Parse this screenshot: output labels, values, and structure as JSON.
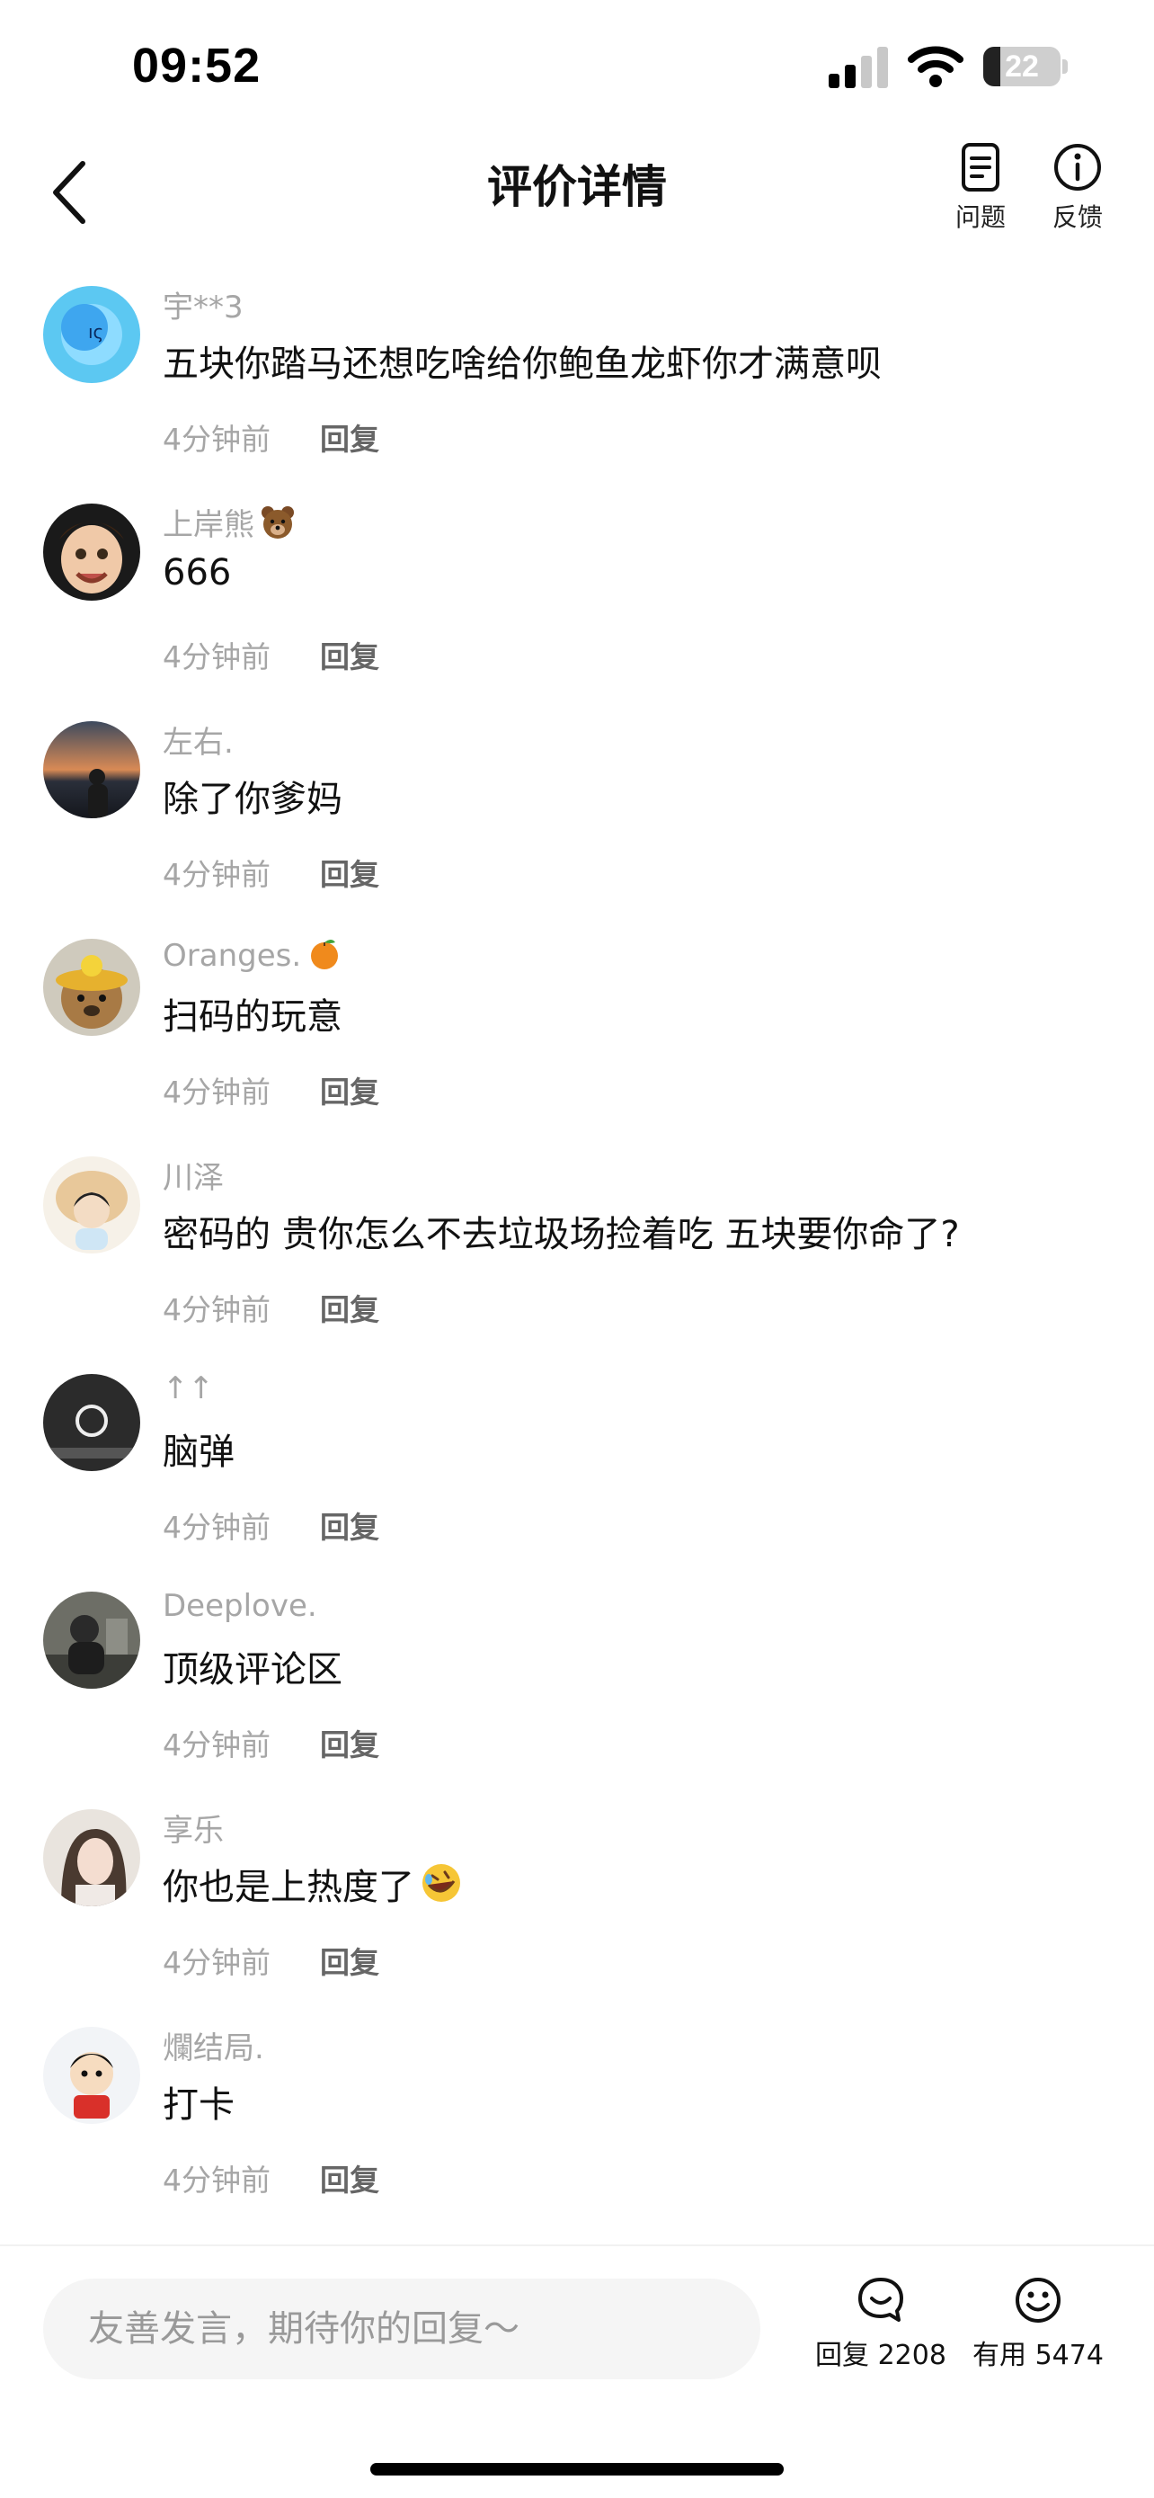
{
  "status_bar": {
    "time": "09:52",
    "battery_level": "22",
    "battery_fraction": 0.22
  },
  "header": {
    "title": "评价详情",
    "actions": {
      "issues_label": "问题",
      "feedback_label": "反馈"
    }
  },
  "comments": [
    {
      "user": "宇**3",
      "text": "五块你踏马还想吃啥给你鲍鱼龙虾你才满意呗",
      "time": "4分钟前",
      "reply": "回复"
    },
    {
      "user": "上岸熊",
      "user_emoji": "bear-face",
      "text": "666",
      "time": "4分钟前",
      "reply": "回复"
    },
    {
      "user": "左右.",
      "text": "除了你爹妈",
      "time": "4分钟前",
      "reply": "回复"
    },
    {
      "user": "Oranges.",
      "user_emoji": "tangerine",
      "text": "扫码的玩意",
      "time": "4分钟前",
      "reply": "回复"
    },
    {
      "user": "川泽",
      "text": "密码的 贵你怎么不去垃圾场捡着吃 五块要你命了?",
      "time": "4分钟前",
      "reply": "回复"
    },
    {
      "user": "↑↑",
      "text": "脑弹",
      "time": "4分钟前",
      "reply": "回复"
    },
    {
      "user": "Deeplove.",
      "text": "顶级评论区",
      "time": "4分钟前",
      "reply": "回复"
    },
    {
      "user": "享乐",
      "text": "你也是上热度了",
      "text_emoji": "rolling-laughing",
      "time": "4分钟前",
      "reply": "回复"
    },
    {
      "user": "爛结局.",
      "text": "打卡",
      "time": "4分钟前",
      "reply": "回复"
    }
  ],
  "bottom_bar": {
    "input_placeholder": "友善发言，期待你的回复～",
    "reply_count_label": "回复 2208",
    "useful_count_label": "有用 5474"
  },
  "colors": {
    "meta_text": "#a6a6a6",
    "input_bg": "#f5f5f5"
  }
}
